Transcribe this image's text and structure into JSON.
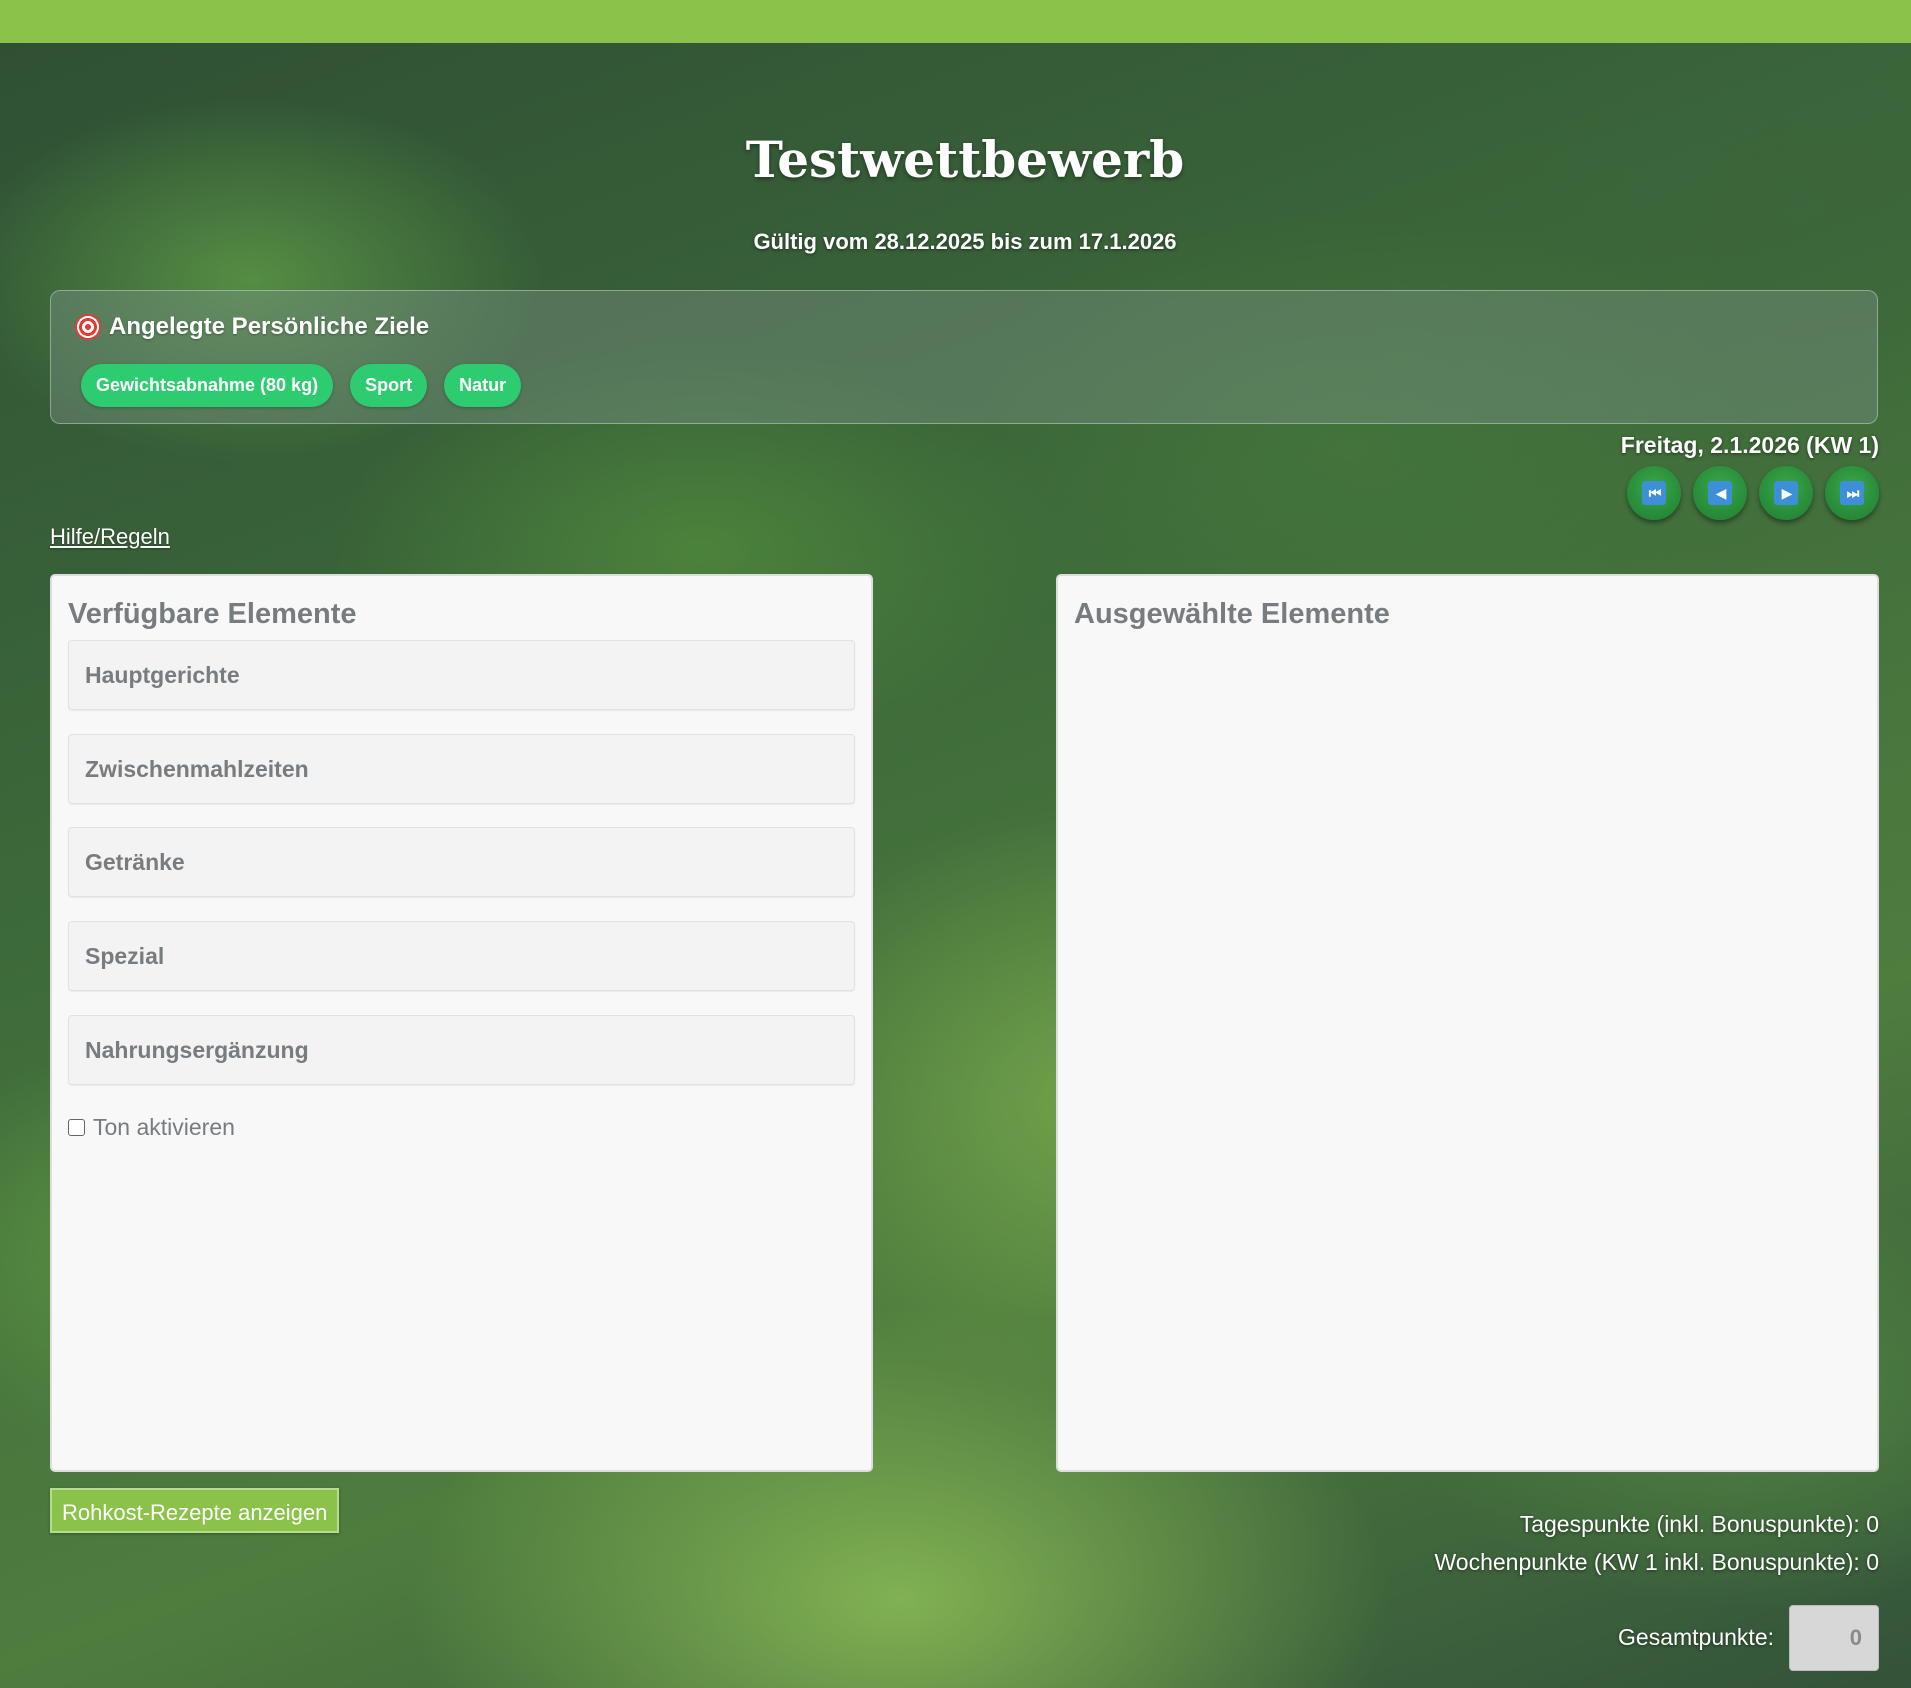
{
  "header": {
    "title": "Testwettbewerb",
    "validity": "Gültig vom 28.12.2025 bis zum 17.1.2026"
  },
  "goals": {
    "heading": "Angelegte Persönliche Ziele",
    "icon": "target-icon",
    "chips": [
      "Gewichtsabnahme (80 kg)",
      "Sport",
      "Natur"
    ],
    "chip_color": "#2ecc71"
  },
  "navigation": {
    "date": "Freitag, 2.1.2026 (KW 1)",
    "buttons": [
      {
        "name": "first",
        "icon": "⏮"
      },
      {
        "name": "previous",
        "icon": "◀"
      },
      {
        "name": "next",
        "icon": "▶"
      },
      {
        "name": "last",
        "icon": "⏭"
      }
    ]
  },
  "help_link": "Hilfe/Regeln",
  "available": {
    "title": "Verfügbare Elemente",
    "categories": [
      "Hauptgerichte",
      "Zwischenmahlzeiten",
      "Getränke",
      "Spezial",
      "Nahrungsergänzung"
    ],
    "sound_label": "Ton aktivieren"
  },
  "selected": {
    "title": "Ausgewählte Elemente"
  },
  "raw_food_button": "Rohkost-Rezepte anzeigen",
  "points": {
    "daily": "Tagespunkte (inkl. Bonuspunkte): 0",
    "weekly": "Wochenpunkte (KW 1 inkl. Bonuspunkte): 0",
    "total_label": "Gesamtpunkte:",
    "total_value": "0"
  },
  "colors": {
    "accent": "#8bc34a",
    "nav_button": "#2e8b3a"
  }
}
